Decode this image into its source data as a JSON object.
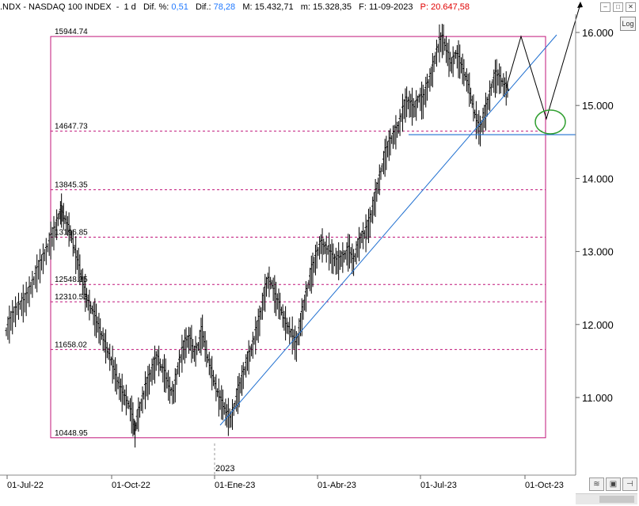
{
  "header": {
    "symbol": ".NDX - NASDAQ 100 INDEX",
    "interval": "1 d",
    "dif_pct_label": "Dif. %:",
    "dif_pct_value": "0,51",
    "dif_label": "Dif.:",
    "dif_value": "78,28",
    "max_label": "M:",
    "max_value": "15.432,71",
    "min_label": "m:",
    "min_value": "15.328,35",
    "date_label": "F:",
    "date_value": "11-09-2023",
    "price_label": "P:",
    "price_value": "20.647,58"
  },
  "buttons": {
    "log": "Log"
  },
  "chart_data": {
    "type": "line",
    "x_tick_labels": [
      "01-Jul-22",
      "01-Oct-22",
      "01-Ene-23",
      "01-Abr-23",
      "01-Jul-23",
      "01-Oct-23"
    ],
    "year_marker": "2023",
    "y_tick_labels": [
      "11.000",
      "12.000",
      "13.000",
      "14.000",
      "15.000",
      "16.000"
    ],
    "ylim": [
      10300,
      16250
    ],
    "fib_levels": [
      "15944.74",
      "14647.73",
      "13845.35",
      "13196.85",
      "12548.35",
      "12310.53",
      "11658.02",
      "10448.95"
    ],
    "fib_values": [
      15944.74,
      14647.73,
      13845.35,
      13196.85,
      12548.35,
      12310.53,
      11658.02,
      10448.95
    ],
    "colors": {
      "fib": "#c0157a",
      "trend": "#1f6fd0",
      "support": "#1f6fd0",
      "circle": "#2e9e2e",
      "price": "#000000"
    },
    "price_series": [
      [
        0,
        11900
      ],
      [
        3,
        12100
      ],
      [
        6,
        12250
      ],
      [
        9,
        12300
      ],
      [
        12,
        12500
      ],
      [
        15,
        12700
      ],
      [
        18,
        12900
      ],
      [
        21,
        13100
      ],
      [
        24,
        13300
      ],
      [
        26,
        13500
      ],
      [
        27,
        13560
      ],
      [
        28,
        13480
      ],
      [
        30,
        13350
      ],
      [
        32,
        13200
      ],
      [
        34,
        12950
      ],
      [
        36,
        12750
      ],
      [
        38,
        12500
      ],
      [
        40,
        12300
      ],
      [
        42,
        12200
      ],
      [
        44,
        12050
      ],
      [
        46,
        11900
      ],
      [
        48,
        11750
      ],
      [
        50,
        11600
      ],
      [
        52,
        11450
      ],
      [
        54,
        11250
      ],
      [
        56,
        11100
      ],
      [
        58,
        11000
      ],
      [
        60,
        10900
      ],
      [
        62,
        10700
      ],
      [
        63,
        10500
      ],
      [
        64,
        10700
      ],
      [
        66,
        10900
      ],
      [
        68,
        11100
      ],
      [
        70,
        11250
      ],
      [
        72,
        11400
      ],
      [
        74,
        11550
      ],
      [
        76,
        11400
      ],
      [
        78,
        11300
      ],
      [
        80,
        11100
      ],
      [
        82,
        11050
      ],
      [
        84,
        11400
      ],
      [
        86,
        11600
      ],
      [
        88,
        11750
      ],
      [
        90,
        11800
      ],
      [
        92,
        11600
      ],
      [
        94,
        11700
      ],
      [
        96,
        11900
      ],
      [
        98,
        11600
      ],
      [
        100,
        11400
      ],
      [
        102,
        11200
      ],
      [
        104,
        11000
      ],
      [
        106,
        10900
      ],
      [
        108,
        10750
      ],
      [
        110,
        10700
      ],
      [
        112,
        10900
      ],
      [
        114,
        11100
      ],
      [
        116,
        11300
      ],
      [
        118,
        11500
      ],
      [
        120,
        11650
      ],
      [
        122,
        11850
      ],
      [
        124,
        12050
      ],
      [
        126,
        12350
      ],
      [
        128,
        12600
      ],
      [
        130,
        12550
      ],
      [
        132,
        12350
      ],
      [
        134,
        12250
      ],
      [
        136,
        12050
      ],
      [
        138,
        11950
      ],
      [
        140,
        11850
      ],
      [
        142,
        11700
      ],
      [
        144,
        12000
      ],
      [
        146,
        12300
      ],
      [
        148,
        12550
      ],
      [
        150,
        12750
      ],
      [
        152,
        12950
      ],
      [
        154,
        13100
      ],
      [
        156,
        13050
      ],
      [
        158,
        13000
      ],
      [
        160,
        12900
      ],
      [
        162,
        12850
      ],
      [
        164,
        12900
      ],
      [
        166,
        12950
      ],
      [
        168,
        13000
      ],
      [
        170,
        12850
      ],
      [
        172,
        13050
      ],
      [
        174,
        13200
      ],
      [
        176,
        13250
      ],
      [
        178,
        13400
      ],
      [
        180,
        13650
      ],
      [
        182,
        13900
      ],
      [
        184,
        14150
      ],
      [
        186,
        14350
      ],
      [
        188,
        14500
      ],
      [
        190,
        14600
      ],
      [
        192,
        14700
      ],
      [
        194,
        14900
      ],
      [
        196,
        15050
      ],
      [
        198,
        15000
      ],
      [
        200,
        14950
      ],
      [
        202,
        15100
      ],
      [
        204,
        15050
      ],
      [
        206,
        15250
      ],
      [
        208,
        15400
      ],
      [
        210,
        15650
      ],
      [
        212,
        15850
      ],
      [
        214,
        15900
      ],
      [
        216,
        15700
      ],
      [
        218,
        15550
      ],
      [
        220,
        15700
      ],
      [
        222,
        15600
      ],
      [
        224,
        15450
      ],
      [
        226,
        15300
      ],
      [
        228,
        15050
      ],
      [
        230,
        14800
      ],
      [
        232,
        14650
      ],
      [
        234,
        14850
      ],
      [
        236,
        15050
      ],
      [
        238,
        15300
      ],
      [
        240,
        15400
      ],
      [
        242,
        15350
      ],
      [
        244,
        15250
      ],
      [
        246,
        15200
      ]
    ],
    "projection": [
      [
        246,
        15200
      ],
      [
        250,
        14950
      ],
      [
        258,
        15944.74
      ],
      [
        276,
        14647.73
      ],
      [
        300,
        16250
      ]
    ]
  }
}
